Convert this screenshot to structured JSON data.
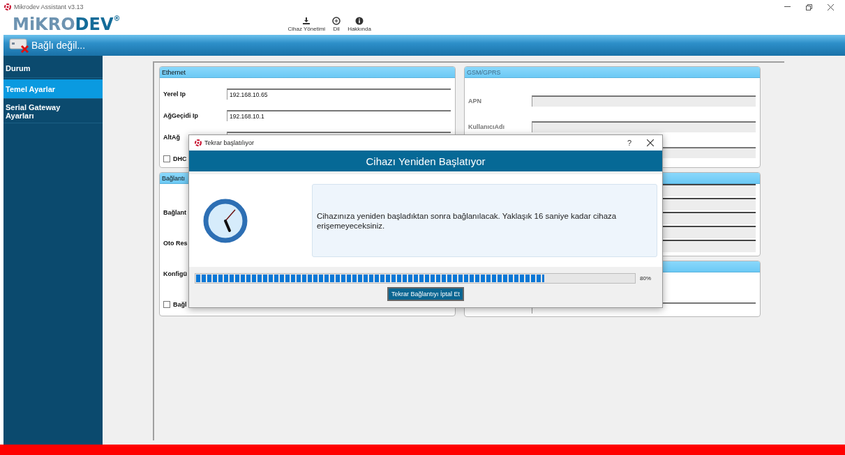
{
  "window": {
    "title": "Mikrodev Assistant v3.13"
  },
  "logo": {
    "part_a": "MiKRO",
    "part_b": "DEV",
    "mark": "®"
  },
  "toolbar": [
    {
      "label": "Cihaz Yönetimi",
      "kind": "download"
    },
    {
      "label": "Dil",
      "kind": "language"
    },
    {
      "label": "Hakkında",
      "kind": "info"
    }
  ],
  "connection": {
    "status": "Bağlı değil...",
    "connected": false
  },
  "sidebar": {
    "items": [
      {
        "label": "Durum",
        "selected": false
      },
      {
        "label": "Temel Ayarlar",
        "selected": true
      },
      {
        "label": "Serial Gateway Ayarları",
        "selected": false
      }
    ]
  },
  "left_panels": [
    {
      "title": "Ethernet",
      "disabled": false,
      "rows": [
        {
          "kind": "field",
          "label": "Yerel Ip",
          "value": "192.168.10.65"
        },
        {
          "kind": "field",
          "label": "AğGeçidi Ip",
          "value": "192.168.10.1"
        },
        {
          "kind": "field",
          "label": "AltAğ"
        },
        {
          "kind": "checkbox",
          "label": "DHC",
          "checked": false
        }
      ]
    },
    {
      "title": "Bağlantı",
      "disabled": false,
      "rows": [
        {
          "kind": "label",
          "label": "Bağlant"
        },
        {
          "kind": "label",
          "label": "Oto Res"
        },
        {
          "kind": "label",
          "label": "Konfigü"
        },
        {
          "kind": "checkbox",
          "label": "Bağl",
          "checked": false
        }
      ]
    }
  ],
  "right_panels": [
    {
      "title": "GSM/GPRS",
      "disabled": true,
      "rows": [
        {
          "kind": "field",
          "label": "APN"
        },
        {
          "kind": "field",
          "label": "KullanıcıAdı"
        },
        {
          "kind": "field"
        }
      ]
    },
    {
      "rows": [
        {
          "kind": "line"
        },
        {
          "kind": "line"
        },
        {
          "kind": "line"
        },
        {
          "kind": "line"
        },
        {
          "kind": "line"
        }
      ]
    },
    {
      "rows": [
        {
          "kind": "field"
        }
      ]
    }
  ],
  "dialog": {
    "title": "Tekrar başlatılıyor",
    "help": "?",
    "heading": "Cihazı Yeniden Başlatıyor",
    "message": "Cihazınıza yeniden başladıktan sonra bağlanılacak. Yaklaşık 16 saniye kadar cihaza erişemeyeceksiniz.",
    "progress": {
      "level": 0.795,
      "reading": "80%"
    },
    "button": "Tekrar Bağlantıyı İptal Et"
  }
}
